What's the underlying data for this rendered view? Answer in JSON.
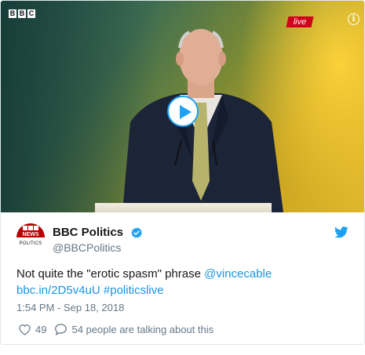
{
  "video": {
    "channel_logo_letters": [
      "B",
      "B",
      "C"
    ],
    "live_badge": "live",
    "info_icon": "info-icon",
    "play_icon": "play-icon"
  },
  "author": {
    "avatar_text_news": "NEWS",
    "avatar_text_politics": "POLITICS",
    "display_name": "BBC Politics",
    "handle": "@BBCPolitics",
    "verified_icon": "verified-badge-icon"
  },
  "tweet": {
    "text": "Not quite the \"erotic spasm\" phrase",
    "mention": "@vincecable",
    "link": "bbc.in/2D5v4uU",
    "hashtag": "#politicslive",
    "timestamp": "1:54 PM - Sep 18, 2018"
  },
  "actions": {
    "like_count": "49",
    "talk_text": "54 people are talking about this"
  },
  "colors": {
    "twitter_blue": "#1da1f2",
    "link_blue": "#1b95e0",
    "bbc_red": "#b80000",
    "live_red": "#d0021b",
    "muted_text": "#657786"
  }
}
